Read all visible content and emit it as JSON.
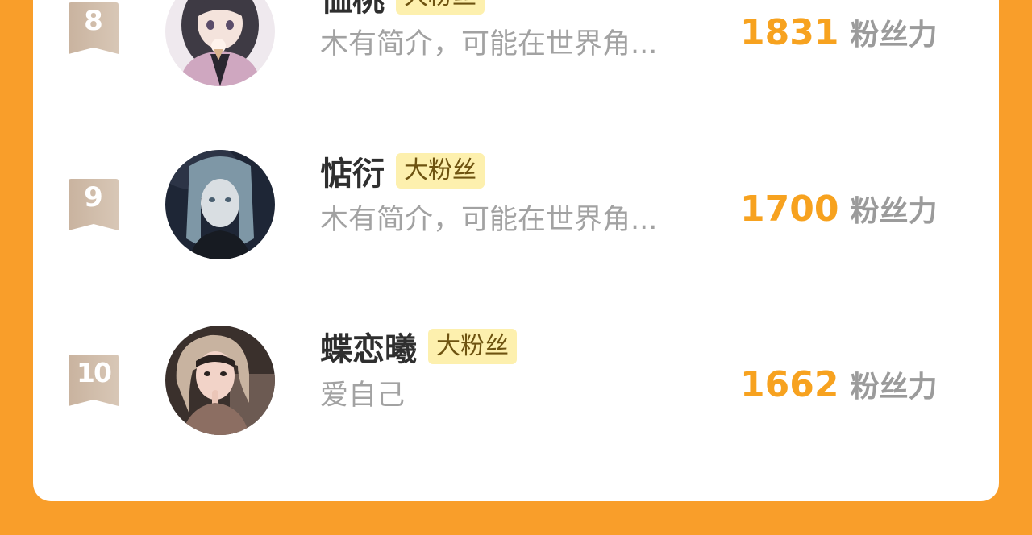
{
  "colors": {
    "page_background": "#F99E2A",
    "card_background": "#FFFFFF",
    "badge_ribbon": "#CDB9A6",
    "score_number": "#F7A21F",
    "tag_background": "#FDF0AE",
    "nickname": "#2F2F2F",
    "bio": "#A2A2A2"
  },
  "fans": [
    {
      "rank": "8",
      "name": "恤桃",
      "tag": "大粉丝",
      "bio": "木有简介，可能在世界角...",
      "score": "1831",
      "unit": "粉丝力",
      "avatar": "avatar-anime-girl-ice-cream"
    },
    {
      "rank": "9",
      "name": "惦衍",
      "tag": "大粉丝",
      "bio": "木有简介，可能在世界角...",
      "score": "1700",
      "unit": "粉丝力",
      "avatar": "avatar-anime-long-hair"
    },
    {
      "rank": "10",
      "name": "蝶恋曦",
      "tag": "大粉丝",
      "bio": "爱自己",
      "score": "1662",
      "unit": "粉丝力",
      "avatar": "avatar-photo-girl-headscarf"
    }
  ]
}
